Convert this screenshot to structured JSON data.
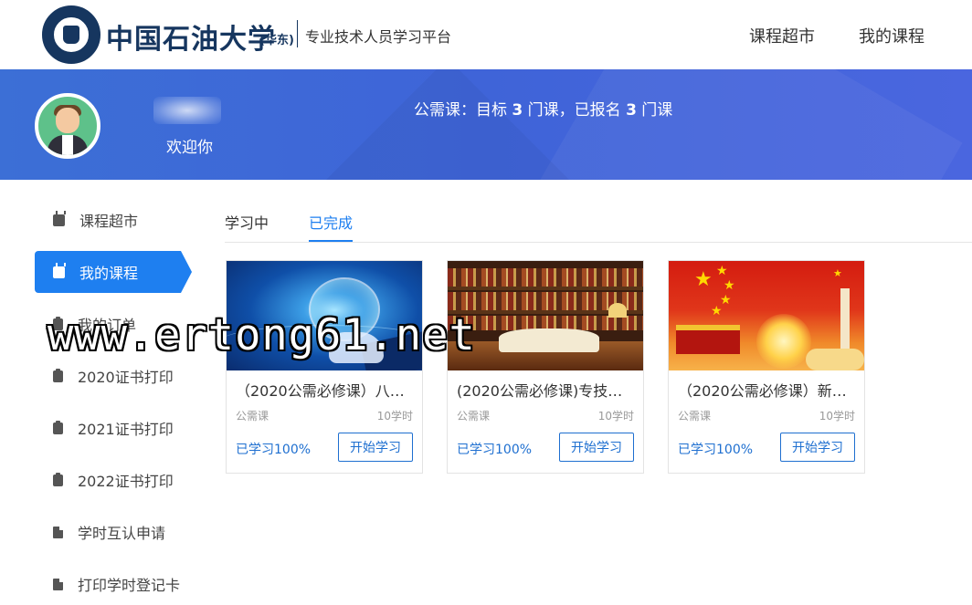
{
  "header": {
    "university_name": "中国石油大学",
    "university_sub": "(华东)",
    "platform_name": "专业技术人员学习平台",
    "nav": [
      "课程超市",
      "我的课程"
    ]
  },
  "banner": {
    "welcome": "欢迎你",
    "summary_prefix": "公需课：目标 ",
    "target_count": "3",
    "summary_mid": " 门课，已报名 ",
    "enrolled_count": "3",
    "summary_suffix": " 门课"
  },
  "sidebar": {
    "items": [
      {
        "label": "课程超市",
        "icon": "tv-icon"
      },
      {
        "label": "我的课程",
        "icon": "tv-icon",
        "active": true
      },
      {
        "label": "我的订单",
        "icon": "clipboard-icon"
      },
      {
        "label": "2020证书打印",
        "icon": "clipboard-icon"
      },
      {
        "label": "2021证书打印",
        "icon": "clipboard-icon"
      },
      {
        "label": "2022证书打印",
        "icon": "clipboard-icon"
      },
      {
        "label": "学时互认申请",
        "icon": "document-icon"
      },
      {
        "label": "打印学时登记卡",
        "icon": "document-icon"
      }
    ]
  },
  "tabs": [
    {
      "label": "学习中"
    },
    {
      "label": "已完成",
      "active": true
    }
  ],
  "courses": [
    {
      "title": "（2020公需必修课）八…",
      "type": "公需课",
      "hours": "10学时",
      "progress": "已学习100%",
      "button": "开始学习"
    },
    {
      "title": "(2020公需必修课)专技人…",
      "type": "公需课",
      "hours": "10学时",
      "progress": "已学习100%",
      "button": "开始学习"
    },
    {
      "title": "（2020公需必修课）新…",
      "type": "公需课",
      "hours": "10学时",
      "progress": "已学习100%",
      "button": "开始学习"
    }
  ],
  "watermark": "www.ertong61.net",
  "colors": {
    "primary": "#1e7ff0",
    "banner": "#3f64d8",
    "brand_navy": "#16365f"
  }
}
